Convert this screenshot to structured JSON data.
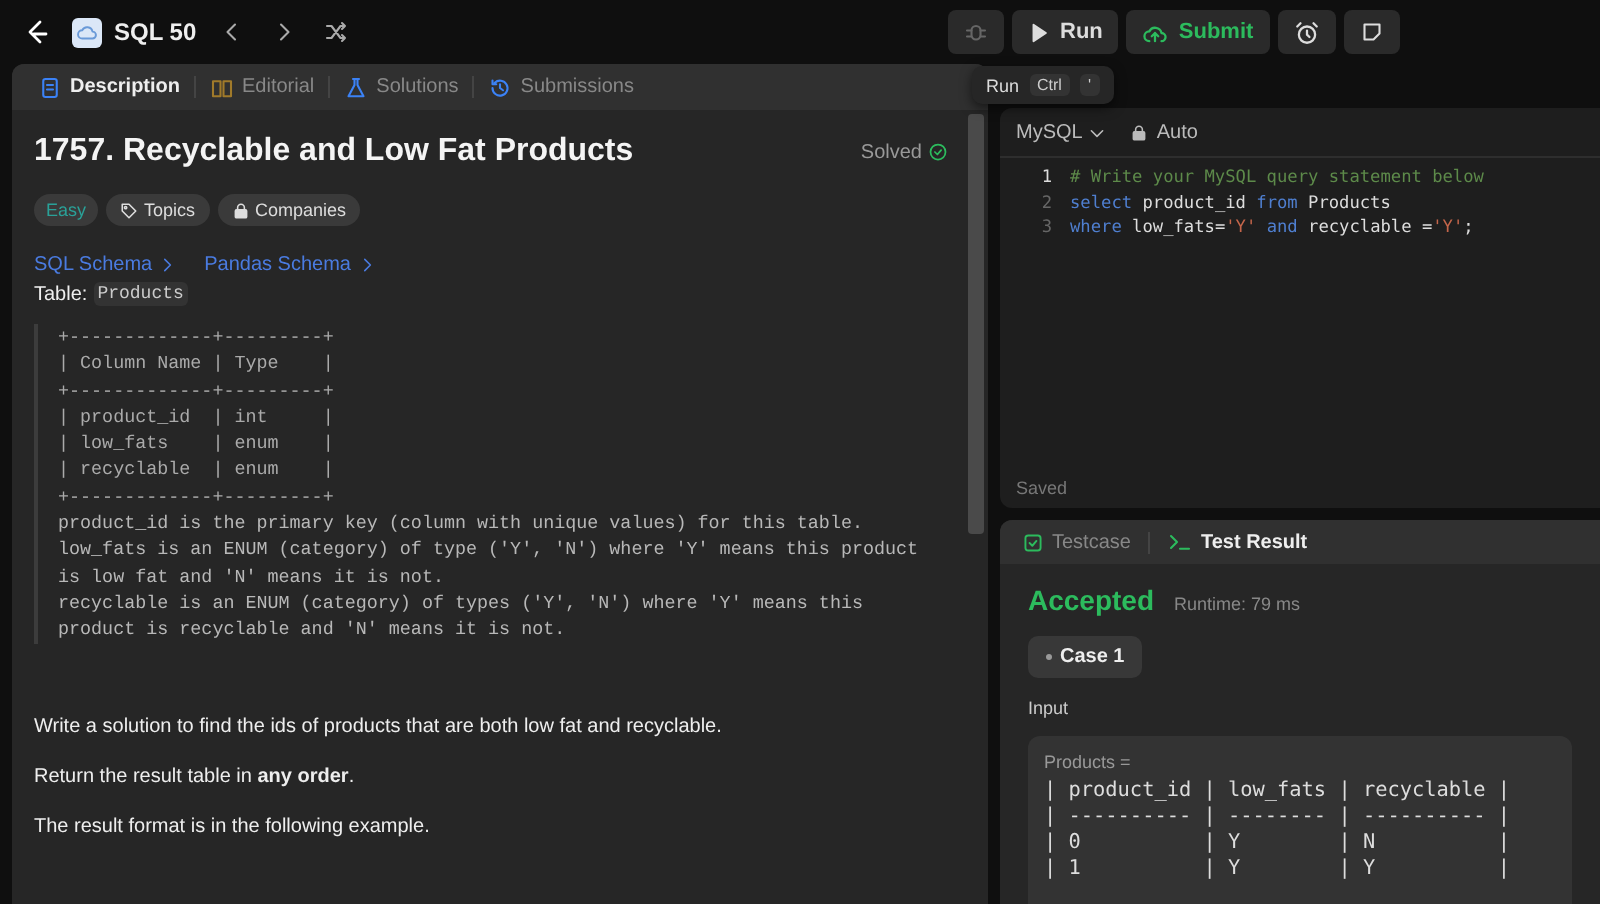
{
  "top_bar": {
    "list_name": "SQL 50",
    "run_label": "Run",
    "submit_label": "Submit"
  },
  "tooltip": {
    "label": "Run",
    "keys": [
      "Ctrl",
      "'"
    ]
  },
  "tabs": [
    {
      "label": "Description",
      "selected": true
    },
    {
      "label": "Editorial",
      "selected": false
    },
    {
      "label": "Solutions",
      "selected": false
    },
    {
      "label": "Submissions",
      "selected": false
    }
  ],
  "problem": {
    "title": "1757. Recyclable and Low Fat Products",
    "status": "Solved",
    "tags": [
      {
        "label": "Easy",
        "kind": "difficulty"
      },
      {
        "label": "Topics",
        "kind": "tag"
      },
      {
        "label": "Companies",
        "kind": "lock"
      }
    ],
    "schema_links": [
      "SQL Schema",
      "Pandas Schema"
    ],
    "table_label": "Table:",
    "table_name": "Products",
    "schema_lines": [
      "+-------------+---------+",
      "| Column Name | Type    |",
      "+-------------+---------+",
      "| product_id  | int     |",
      "| low_fats    | enum    |",
      "| recyclable  | enum    |",
      "+-------------+---------+"
    ],
    "schema_notes": [
      "product_id is the primary key (column with unique values) for this table.",
      "low_fats is an ENUM (category) of type ('Y', 'N') where 'Y' means this product is low fat and 'N' means it is not.",
      "recyclable is an ENUM (category) of types ('Y', 'N') where 'Y' means this product is recyclable and 'N' means it is not."
    ],
    "paragraphs": [
      "Write a solution to find the ids of products that are both low fat and recyclable.",
      "Return the result table in **any order**.",
      "The result format is in the following example."
    ]
  },
  "editor": {
    "language": "MySQL",
    "mode": "Auto",
    "status": "Saved",
    "lines": [
      {
        "number": "1",
        "current": true,
        "tokens": [
          {
            "text": "# Write your MySQL query statement below",
            "kind": "comment"
          }
        ]
      },
      {
        "number": "2",
        "current": false,
        "tokens": [
          {
            "text": "select",
            "kind": "keyword"
          },
          {
            "text": " product_id ",
            "kind": "plain"
          },
          {
            "text": "from",
            "kind": "keyword"
          },
          {
            "text": " Products",
            "kind": "plain"
          }
        ]
      },
      {
        "number": "3",
        "current": false,
        "tokens": [
          {
            "text": "where",
            "kind": "keyword"
          },
          {
            "text": " low_fats=",
            "kind": "plain"
          },
          {
            "text": "'Y'",
            "kind": "string"
          },
          {
            "text": " and",
            "kind": "keyword"
          },
          {
            "text": " recyclable =",
            "kind": "plain"
          },
          {
            "text": "'Y'",
            "kind": "string"
          },
          {
            "text": ";",
            "kind": "plain"
          }
        ]
      }
    ]
  },
  "result": {
    "tabs": [
      {
        "label": "Testcase",
        "selected": false
      },
      {
        "label": "Test Result",
        "selected": true
      }
    ],
    "verdict": "Accepted",
    "runtime": "Runtime: 79 ms",
    "cases": [
      {
        "label": "Case 1",
        "selected": true
      }
    ],
    "input_label": "Input",
    "var_label": "Products =",
    "rows": [
      "| product_id | low_fats | recyclable |",
      "| ---------- | -------- | ---------- |",
      "| 0          | Y        | N          |",
      "| 1          | Y        | Y          |"
    ]
  }
}
